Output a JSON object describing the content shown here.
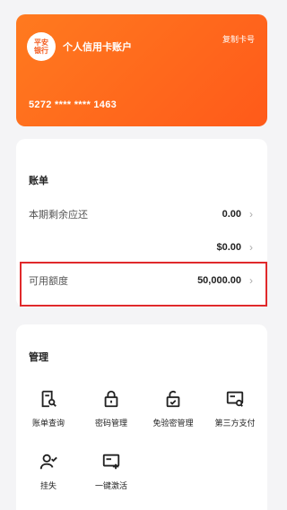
{
  "card": {
    "logo_text": "平安\n银行",
    "title": "个人信用卡账户",
    "copy_label": "复制卡号",
    "number": "5272 **** **** 1463"
  },
  "bill": {
    "title": "账单",
    "rows": [
      {
        "label": "本期剩余应还",
        "value": "0.00"
      },
      {
        "label": "",
        "value": "$0.00"
      },
      {
        "label": "可用额度",
        "value": "50,000.00"
      }
    ]
  },
  "manage": {
    "title": "管理",
    "items": [
      {
        "label": "账单查询",
        "icon": "bill-search-icon"
      },
      {
        "label": "密码管理",
        "icon": "lock-icon"
      },
      {
        "label": "免验密管理",
        "icon": "unlock-icon"
      },
      {
        "label": "第三方支付",
        "icon": "card-payment-icon"
      },
      {
        "label": "挂失",
        "icon": "user-report-icon"
      },
      {
        "label": "一键激活",
        "icon": "card-activate-icon"
      }
    ]
  },
  "colors": {
    "card_gradient_start": "#ff7a1f",
    "card_gradient_end": "#ff5a1a",
    "highlight_border": "#e0292b"
  }
}
